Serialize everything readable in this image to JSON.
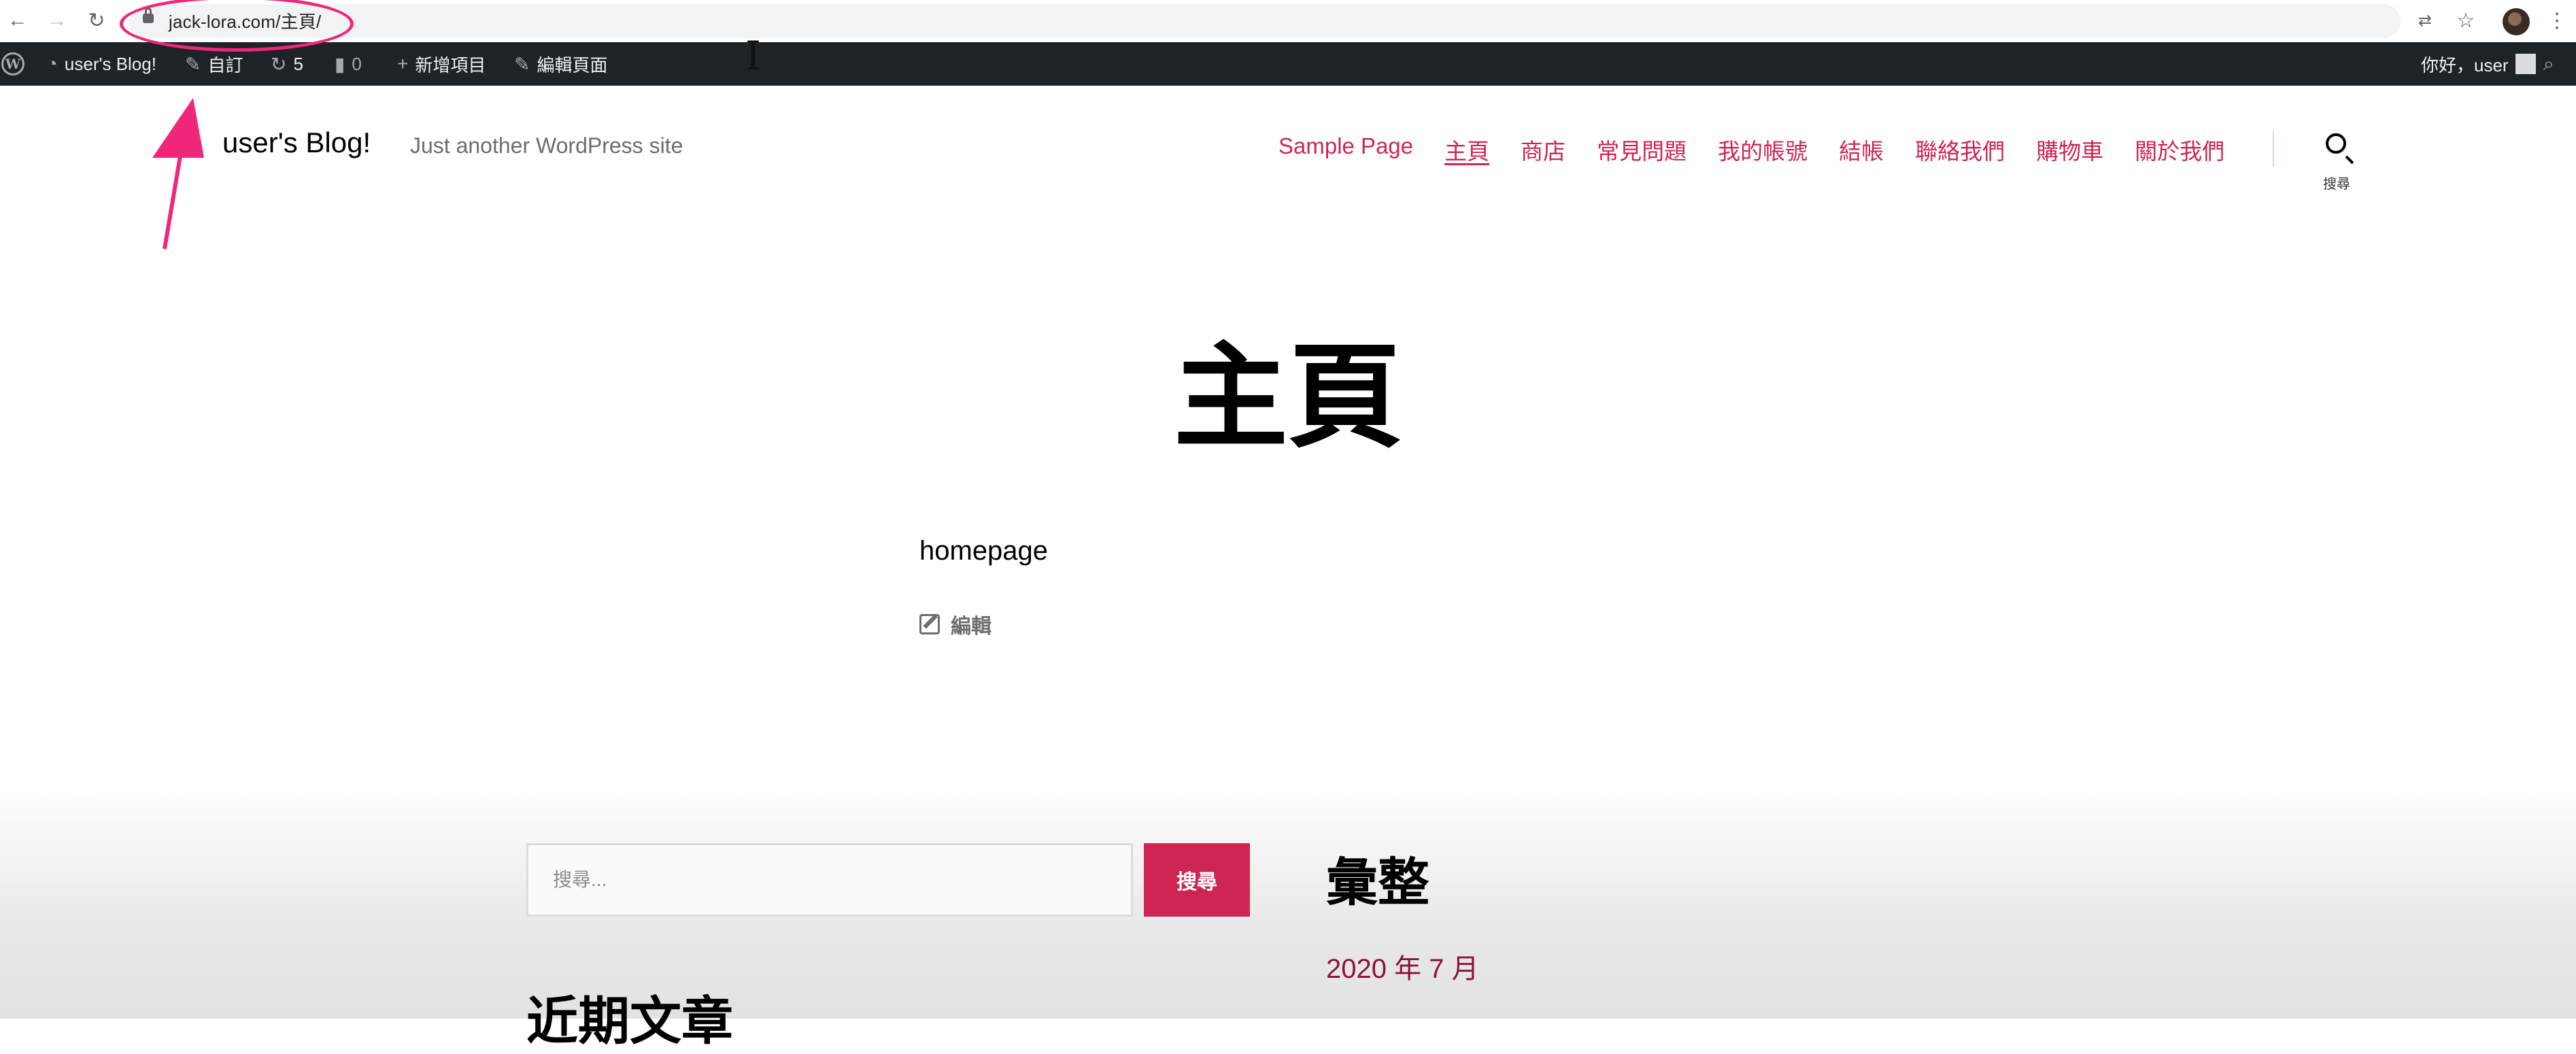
{
  "browser": {
    "url": "jack-lora.com/主頁/",
    "back_icon": "arrow-left-icon",
    "forward_icon": "arrow-right-icon",
    "reload_icon": "reload-icon",
    "translate_icon": "translate-icon",
    "bookmark_icon": "star-icon",
    "menu_icon": "kebab-menu-icon"
  },
  "admin_bar": {
    "site_name": "user's Blog!",
    "customize": "自訂",
    "updates_count": "5",
    "comments_count": "0",
    "new_item": "新增項目",
    "edit_page": "編輯頁面",
    "greeting": "你好，user"
  },
  "site": {
    "title": "user's Blog!",
    "description": "Just another WordPress site"
  },
  "nav": {
    "items": [
      {
        "label": "Sample Page"
      },
      {
        "label": "主頁",
        "current": true
      },
      {
        "label": "商店"
      },
      {
        "label": "常見問題"
      },
      {
        "label": "我的帳號"
      },
      {
        "label": "結帳"
      },
      {
        "label": "聯絡我們"
      },
      {
        "label": "購物車"
      },
      {
        "label": "關於我們"
      }
    ],
    "search_label": "搜尋"
  },
  "page": {
    "heading": "主頁",
    "content": "homepage",
    "edit_label": "編輯"
  },
  "widgets": {
    "search_placeholder": "搜尋...",
    "search_button": "搜尋",
    "archives_title": "彙整",
    "archive_month": "2020 年 7 月",
    "recent_posts_title": "近期文章"
  },
  "colors": {
    "accent": "#cd2653",
    "admin_bar": "#1d2327",
    "annotation": "#f0267a"
  }
}
